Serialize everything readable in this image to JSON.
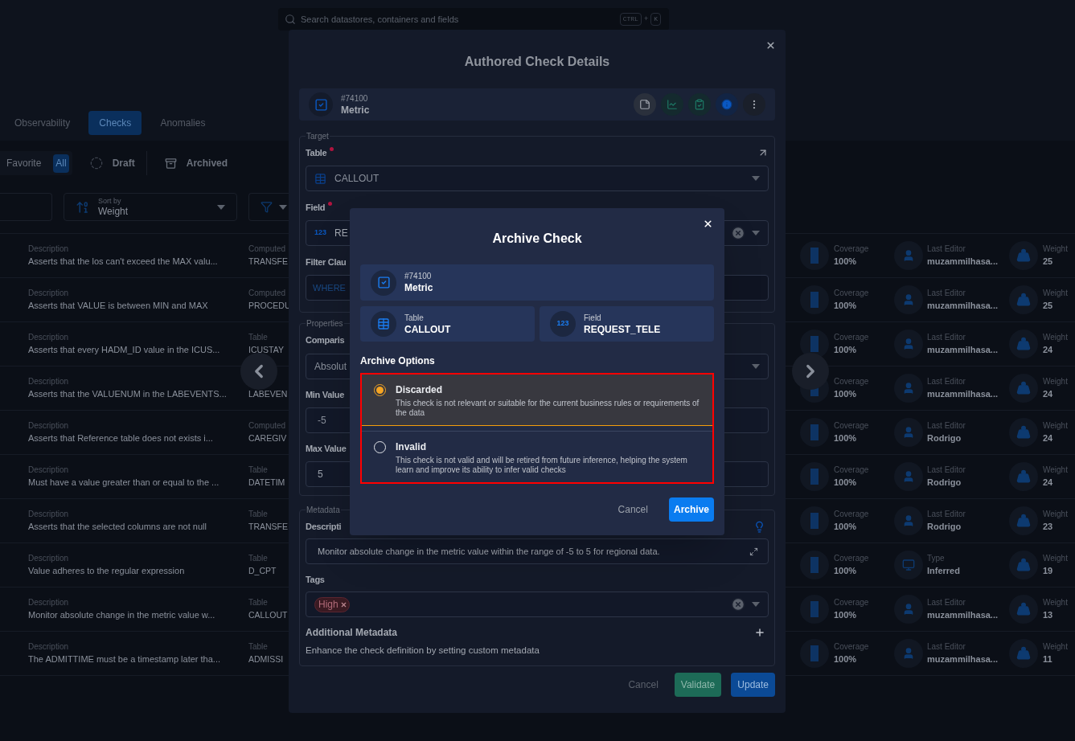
{
  "search": {
    "placeholder": "Search datastores, containers and fields",
    "keys": [
      "CTRL",
      "+",
      "K"
    ]
  },
  "tabs": [
    {
      "label": "Observability",
      "selected": false
    },
    {
      "label": "Checks",
      "selected": true
    },
    {
      "label": "Anomalies",
      "selected": false
    }
  ],
  "status_filter": [
    {
      "label": "Favorite",
      "selected": false
    },
    {
      "label": "All",
      "selected": true
    }
  ],
  "status_links": [
    {
      "label": "Draft",
      "kind": "draft"
    },
    {
      "label": "Archived",
      "kind": "archived"
    }
  ],
  "sort": {
    "label": "Sort by",
    "value": "Weight"
  },
  "checks": [
    {
      "desc_label": "Description",
      "desc": "Asserts that the los can't exceed the MAX valu...",
      "src_label": "Computed",
      "src": "TRANSFE",
      "cov_label": "Coverage",
      "cov": "100%",
      "kind": "user",
      "editor_label": "Last Editor",
      "editor": "muzammilhasa...",
      "weight_label": "Weight",
      "weight": "25"
    },
    {
      "desc_label": "Description",
      "desc": "Asserts that VALUE is between MIN and MAX",
      "src_label": "Computed",
      "src": "PROCEDU",
      "cov_label": "Coverage",
      "cov": "100%",
      "kind": "user",
      "editor_label": "Last Editor",
      "editor": "muzammilhasa...",
      "weight_label": "Weight",
      "weight": "25"
    },
    {
      "desc_label": "Description",
      "desc": "Asserts that every HADM_ID value in the ICUS...",
      "src_label": "Table",
      "src": "ICUSTAY",
      "cov_label": "Coverage",
      "cov": "100%",
      "kind": "user",
      "editor_label": "Last Editor",
      "editor": "muzammilhasa...",
      "weight_label": "Weight",
      "weight": "24"
    },
    {
      "desc_label": "Description",
      "desc": "Asserts that the VALUENUM in the LABEVENTS...",
      "src": "LABEVEN",
      "cov_label": "Coverage",
      "cov": "100%",
      "kind": "user",
      "editor_label": "Last Editor",
      "editor": "muzammilhasa...",
      "weight_label": "Weight",
      "weight": "24"
    },
    {
      "desc_label": "Description",
      "desc": "Asserts that Reference table does not exists i...",
      "src_label": "Computed",
      "src": "CAREGIV",
      "cov_label": "Coverage",
      "cov": "100%",
      "kind": "user",
      "editor_label": "Last Editor",
      "editor": "Rodrigo",
      "weight_label": "Weight",
      "weight": "24"
    },
    {
      "desc_label": "Description",
      "desc": "Must have a value greater than or equal to the ...",
      "src_label": "Table",
      "src": "DATETIM",
      "cov_label": "Coverage",
      "cov": "100%",
      "kind": "user",
      "editor_label": "Last Editor",
      "editor": "Rodrigo",
      "weight_label": "Weight",
      "weight": "24"
    },
    {
      "desc_label": "Description",
      "desc": "Asserts that the selected columns are not null",
      "src_label": "Table",
      "src": "TRANSFE",
      "cov_label": "Coverage",
      "cov": "100%",
      "kind": "user",
      "editor_label": "Last Editor",
      "editor": "Rodrigo",
      "weight_label": "Weight",
      "weight": "23"
    },
    {
      "desc_label": "Description",
      "desc": "Value adheres to the regular expression",
      "src_label": "Table",
      "src": "D_CPT",
      "cov_label": "Coverage",
      "cov": "100%",
      "kind": "inferred",
      "editor_label": "Type",
      "editor": "Inferred",
      "weight_label": "Weight",
      "weight": "19"
    },
    {
      "desc_label": "Description",
      "desc": "Monitor absolute change in the metric value w...",
      "src_label": "Table",
      "src": "CALLOUT",
      "cov_label": "Coverage",
      "cov": "100%",
      "kind": "user",
      "editor_label": "Last Editor",
      "editor": "muzammilhasa...",
      "weight_label": "Weight",
      "weight": "13"
    },
    {
      "desc_label": "Description",
      "desc": "The ADMITTIME must be a timestamp later tha...",
      "src_label": "Table",
      "src": "ADMISSI",
      "cov_label": "Coverage",
      "cov": "100%",
      "kind": "user",
      "editor_label": "Last Editor",
      "editor": "muzammilhasa...",
      "weight_label": "Weight",
      "weight": "11"
    }
  ],
  "check_details": {
    "title": "Authored Check Details",
    "id": "#74100",
    "type": "Metric",
    "target_legend": "Target",
    "table": {
      "label": "Table",
      "required": true,
      "value": "CALLOUT"
    },
    "field": {
      "label": "Field",
      "required": true,
      "type_badge": "123",
      "value": "RE"
    },
    "filter": {
      "label": "Filter Clau",
      "placeholder": "WHERE"
    },
    "properties_legend": "Properties",
    "comparison": {
      "label": "Comparis",
      "value": "Absolut"
    },
    "min": {
      "label": "Min Value",
      "value": "-5"
    },
    "max": {
      "label": "Max Value",
      "value": "5"
    },
    "metadata_legend": "Metadata",
    "description": {
      "label": "Descripti",
      "value": "Monitor absolute change in the metric value within the range of -5 to 5 for regional data."
    },
    "tags": {
      "label": "Tags",
      "items": [
        "High"
      ]
    },
    "additional": {
      "label": "Additional Metadata",
      "hint": "Enhance the check definition by setting custom metadata"
    },
    "buttons": [
      {
        "label": "Cancel",
        "kind": "text"
      },
      {
        "label": "Validate",
        "kind": "validate"
      },
      {
        "label": "Update",
        "kind": "primary"
      }
    ]
  },
  "archive_dialog": {
    "title": "Archive Check",
    "id": "#74100",
    "type": "Metric",
    "table": {
      "label": "Table",
      "value": "CALLOUT"
    },
    "field": {
      "label": "Field",
      "type_badge": "123",
      "value": "REQUEST_TELE"
    },
    "options_label": "Archive Options",
    "options": [
      {
        "label": "Discarded",
        "description": "This check is not relevant or suitable for the current business rules or requirements of the data",
        "selected": true
      },
      {
        "label": "Invalid",
        "description": "This check is not valid and will be retired from future inference, helping the system learn and improve its ability to infer valid checks",
        "selected": false
      }
    ],
    "buttons": [
      {
        "label": "Cancel",
        "kind": "text"
      },
      {
        "label": "Archive",
        "kind": "primary"
      }
    ]
  }
}
